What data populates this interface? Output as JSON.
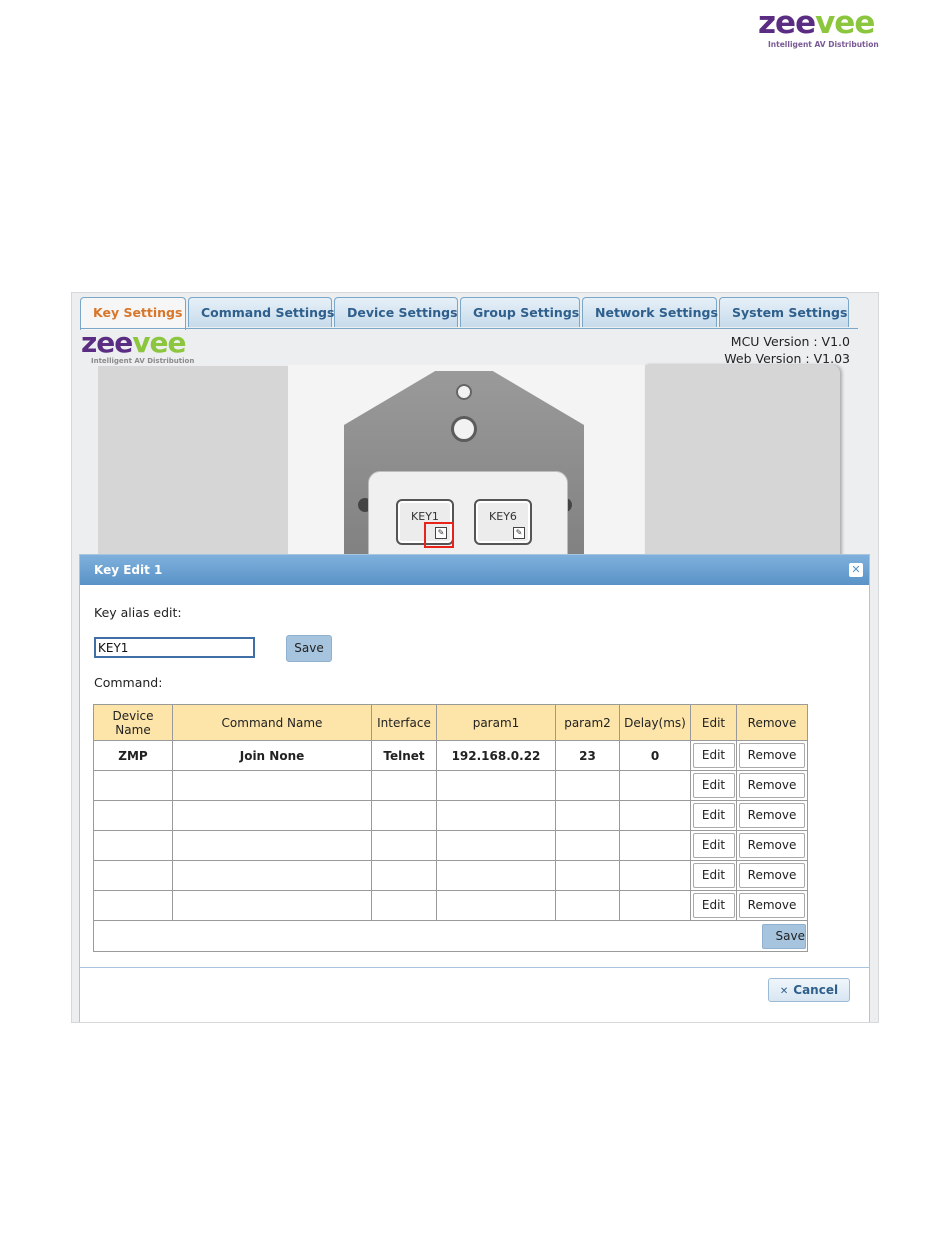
{
  "brand": {
    "logo_left": "zee",
    "logo_right": "vee",
    "tagline": "Intelligent AV Distribution",
    "color_primary": "#5b2d82",
    "color_accent": "#8cc63f"
  },
  "tabs": [
    {
      "label": "Key Settings",
      "active": true
    },
    {
      "label": "Command Settings",
      "active": false
    },
    {
      "label": "Device Settings",
      "active": false
    },
    {
      "label": "Group Settings",
      "active": false
    },
    {
      "label": "Network Settings",
      "active": false
    },
    {
      "label": "System Settings",
      "active": false
    }
  ],
  "versions": {
    "mcu": "MCU Version : V1.0",
    "web": "Web Version : V1.03"
  },
  "keys": {
    "key1": "KEY1",
    "key6": "KEY6",
    "edit_icon": "edit-icon"
  },
  "dialog": {
    "title": "Key Edit 1",
    "close_icon": "close-icon",
    "alias_label": "Key alias edit:",
    "alias_value": "KEY1",
    "save_label": "Save",
    "command_label": "Command:",
    "table": {
      "headers": [
        "Device Name",
        "Command Name",
        "Interface",
        "param1",
        "param2",
        "Delay(ms)",
        "Edit",
        "Remove"
      ],
      "rows": [
        {
          "device": "ZMP",
          "command": "Join None",
          "interface": "Telnet",
          "param1": "192.168.0.22",
          "param2": "23",
          "delay": "0"
        },
        {
          "device": "",
          "command": "",
          "interface": "",
          "param1": "",
          "param2": "",
          "delay": ""
        },
        {
          "device": "",
          "command": "",
          "interface": "",
          "param1": "",
          "param2": "",
          "delay": ""
        },
        {
          "device": "",
          "command": "",
          "interface": "",
          "param1": "",
          "param2": "",
          "delay": ""
        },
        {
          "device": "",
          "command": "",
          "interface": "",
          "param1": "",
          "param2": "",
          "delay": ""
        },
        {
          "device": "",
          "command": "",
          "interface": "",
          "param1": "",
          "param2": "",
          "delay": ""
        }
      ],
      "edit_label": "Edit",
      "remove_label": "Remove",
      "save_label": "Save"
    },
    "cancel_label": "Cancel",
    "cancel_icon": "x-icon"
  }
}
